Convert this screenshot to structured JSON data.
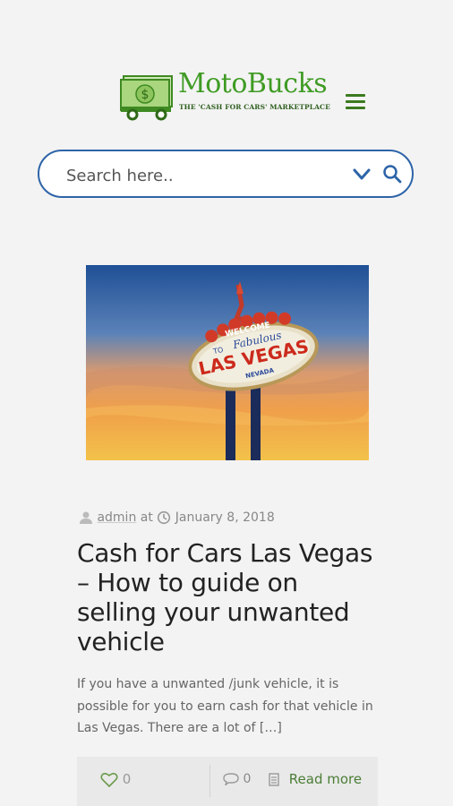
{
  "header": {
    "logo_title": "MotoBucks",
    "logo_subtitle": "THE 'CASH FOR CARS' MARKETPLACE"
  },
  "search": {
    "placeholder": "Search here.."
  },
  "post": {
    "image_sign_text": [
      "WELCOME",
      "TO",
      "Fabulous",
      "LAS VEGAS",
      "NEVADA"
    ],
    "author": "admin",
    "at_text": "at",
    "date": "January 8, 2018",
    "title": "Cash for Cars Las Vegas – How to guide on selling your unwanted vehicle",
    "excerpt": "If you have a unwanted /junk vehicle, it is possible for you to earn cash for that vehicle in Las Vegas. There are a lot of […]",
    "likes": "0",
    "comments": "0",
    "read_more": "Read more"
  },
  "colors": {
    "brand_green": "#3f9b24",
    "search_border": "#2d64a8",
    "readmore_green": "#4a7d35"
  },
  "icons": [
    "money-car-logo",
    "hamburger-menu-icon",
    "chevron-down-icon",
    "search-icon",
    "user-icon",
    "clock-icon",
    "heart-icon",
    "comment-icon",
    "document-icon"
  ]
}
